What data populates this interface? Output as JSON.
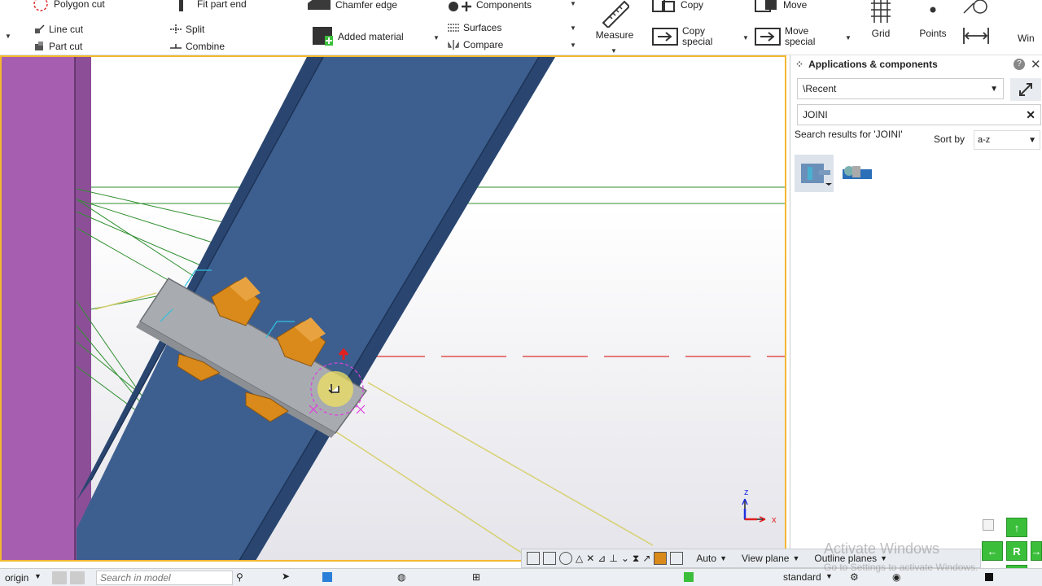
{
  "ribbon": {
    "polygon_cut": "Polygon cut",
    "line_cut": "Line cut",
    "part_cut": "Part cut",
    "fit_part_end": "Fit part end",
    "split": "Split",
    "combine": "Combine",
    "chamfer_edge": "Chamfer edge",
    "added_material": "Added material",
    "components": "Components",
    "surfaces": "Surfaces",
    "compare": "Compare",
    "measure": "Measure",
    "copy": "Copy",
    "copy_special_1": "Copy",
    "copy_special_2": "special",
    "move": "Move",
    "move_special_1": "Move",
    "move_special_2": "special",
    "grid": "Grid",
    "points": "Points",
    "win": "Win"
  },
  "panel": {
    "title": "Applications & components",
    "recent": "\\Recent",
    "search_value": "JOINI",
    "results_label": "Search results for 'JOINI'",
    "sort_label": "Sort by",
    "sort_value": "a-z"
  },
  "view_toolbar": {
    "auto": "Auto",
    "view_plane": "View plane",
    "outline_planes": "Outline planes"
  },
  "statusbar": {
    "origin": "origin",
    "search_placeholder": "Search in model",
    "standard": "standard"
  },
  "nav": {
    "r": "R"
  },
  "watermark": {
    "line1": "Activate Windows",
    "line2": "Go to Settings to activate Windows."
  },
  "axes": {
    "z": "z",
    "x": "x"
  },
  "colors": {
    "beam": "#3d5f8f",
    "column": "#a65fb0",
    "bolt": "#d98a1a",
    "plate": "#a8abb0",
    "selection": "#f2b830"
  }
}
